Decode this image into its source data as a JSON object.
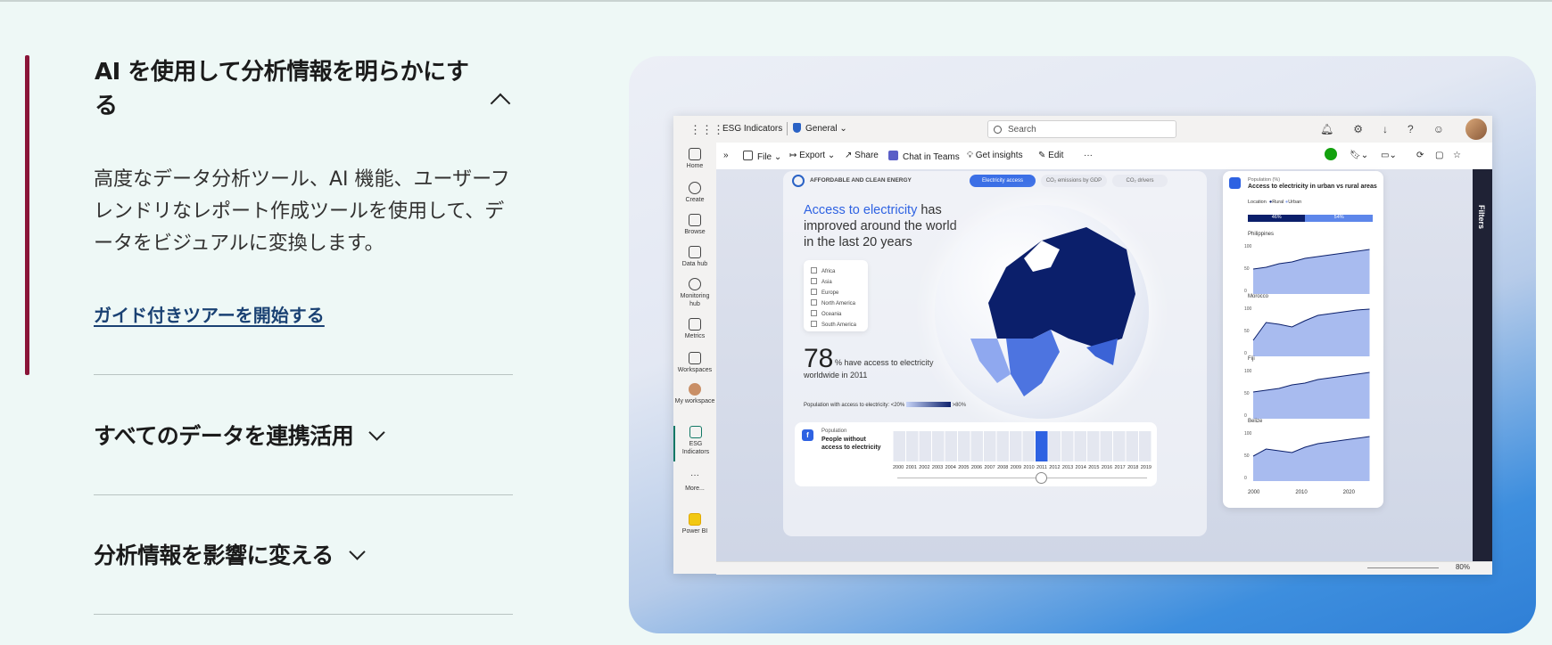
{
  "accordion": {
    "item1": {
      "title": "AI を使用して分析情報を明らかにする",
      "body": "高度なデータ分析ツール、AI 機能、ユーザーフレンドリなレポート作成ツールを使用して、データをビジュアルに変換します。",
      "link": "ガイド付きツアーを開始する"
    },
    "item2": {
      "title": "すべてのデータを連携活用"
    },
    "item3": {
      "title": "分析情報を影響に変える"
    }
  },
  "app": {
    "workspace": "ESG Indicators",
    "section": "General",
    "search_placeholder": "Search",
    "nav": [
      {
        "label": "Home",
        "icon": "home-icon"
      },
      {
        "label": "Create",
        "icon": "plus-icon"
      },
      {
        "label": "Browse",
        "icon": "folder-icon"
      },
      {
        "label": "Data hub",
        "icon": "database-icon"
      },
      {
        "label": "Monitoring hub",
        "icon": "monitor-icon"
      },
      {
        "label": "Metrics",
        "icon": "trophy-icon"
      },
      {
        "label": "Workspaces",
        "icon": "workspaces-icon"
      },
      {
        "label": "My workspace",
        "icon": "avatar-icon"
      },
      {
        "label": "ESG Indicators",
        "icon": "report-icon"
      },
      {
        "label": "More...",
        "icon": "more-icon"
      },
      {
        "label": "Power BI",
        "icon": "powerbi-icon"
      }
    ],
    "toolbar": {
      "file": "File",
      "export": "Export",
      "share": "Share",
      "chat": "Chat in Teams",
      "insights": "Get insights",
      "edit": "Edit",
      "more": "···"
    },
    "filters_label": "Filters",
    "zoom": "80%"
  },
  "report": {
    "header": "AFFORDABLE AND CLEAN ENERGY",
    "tabs": [
      "Electricity access",
      "CO₂ emissions by GDP",
      "CO₂ drivers"
    ],
    "title_highlight": "Access to electricity",
    "title_rest": " has improved around the world in the last 20 years",
    "regions": [
      "Africa",
      "Asia",
      "Europe",
      "North America",
      "Oceania",
      "South America"
    ],
    "stat_value": "78",
    "stat_text": "% have access to electricity",
    "stat_sub": "worldwide in 2011",
    "scale_text": "Population with access to electricity:",
    "scale_low": "<20%",
    "scale_high": ">80%",
    "pop_label": "Population",
    "pop_title": "People without access to electricity",
    "years": [
      "2000",
      "2001",
      "2002",
      "2003",
      "2004",
      "2005",
      "2006",
      "2007",
      "2008",
      "2009",
      "2010",
      "2011",
      "2012",
      "2013",
      "2014",
      "2015",
      "2016",
      "2017",
      "2018",
      "2019"
    ],
    "selected_year": "2011",
    "panel": {
      "label": "Population (%)",
      "title": "Access to electricity in urban vs rural areas",
      "location_label": "Location",
      "rural": "Rural",
      "urban": "Urban",
      "rural_pct": "46%",
      "urban_pct": "54%",
      "countries": [
        "Philippines",
        "Morocco",
        "Fiji",
        "Belize"
      ],
      "y_ticks": [
        "100",
        "50",
        "0"
      ],
      "x_ticks": [
        "2000",
        "2010",
        "2020"
      ]
    },
    "colors": {
      "accent": "#2e62e2",
      "dark": "#0b1f6b",
      "light": "#8fa8ef"
    }
  }
}
